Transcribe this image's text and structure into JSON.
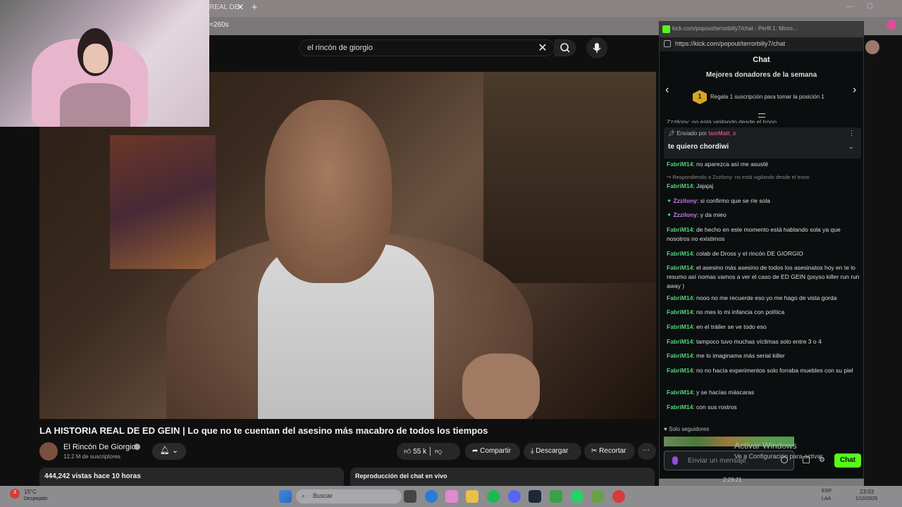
{
  "browser": {
    "tab_title": "REAL DE ED",
    "url_fragment": "=260s",
    "new_tab": "+",
    "close": "✕"
  },
  "youtube": {
    "search_query": "el rincón de giorgio",
    "video_title": "LA HISTORIA REAL DE ED GEIN | Lo que no te cuentan del asesino más macabro de todos los tiempos",
    "channel_name": "El Rincón De Giorgio",
    "subscribers": "12.2 M de suscriptores",
    "likes": "55 k",
    "share": "Compartir",
    "download": "Descargar",
    "clip": "Recortar",
    "views": "444,242 vistas  hace 10 horas",
    "replay_chat": "Reproducción del chat en vivo"
  },
  "kick": {
    "window_title": "kick.com/popout/terrorbilly7/chat - Perfil 1: Micro...",
    "url": "https://kick.com/popout/terrorbilly7/chat",
    "header": "Chat",
    "donors_title": "Mejores donadores de la semana",
    "donors_badge": "1",
    "donors_text": "Regala 1 suscripción para tomar la posición 1",
    "partial_msg": "Zzzilony: no está vigilando desde el trono",
    "pinned_by": "Enviado por",
    "pinned_user": "IamMatt_x",
    "pinned_text": "te quiero chordiwi",
    "reply_to": "Respondiendo a Zzzilony: no está vigilando desde el trono",
    "messages": [
      {
        "user": "FabriM14",
        "text": "no aparezca así me asusté"
      },
      {
        "user": "FabriM14",
        "text": "Jajajaj"
      },
      {
        "user": "Zzzilony",
        "text": "si confirmo que se ríe sola"
      },
      {
        "user": "Zzzilony",
        "text": "y da mieo"
      },
      {
        "user": "FabriM14",
        "text": "de hecho en este momento está hablando sola ya que nosotros no existimos"
      },
      {
        "user": "FabriM14",
        "text": "colab de Dross y el rincón DE GIORGIO"
      },
      {
        "user": "FabriM14",
        "text": "el asesino más asesino de todos los asesinatos hoy en te lo resumo así nomas vamos a ver el caso de ED GEIN (psyso killer run run away )"
      },
      {
        "user": "FabriM14",
        "text": "nooo no me recuerde eso yo me hago de vista gorda"
      },
      {
        "user": "FabriM14",
        "text": "no mes lo mi infancia con política"
      },
      {
        "user": "FabriM14",
        "text": "en el tráiler se ve todo eso"
      },
      {
        "user": "FabriM14",
        "text": "tampoco tuvo muchas víctimas solo entre 3 o 4"
      },
      {
        "user": "FabriM14",
        "text": "me lo imaginama más serial killer"
      },
      {
        "user": "FabriM14",
        "text": "no no hacía experimentos solo forraba muebles con su piel"
      },
      {
        "user": "FabriM14",
        "text": "y se hacías máscaras"
      },
      {
        "user": "FabriM14",
        "text": "con sus rostros"
      }
    ],
    "followers_only": "Solo seguidores",
    "input_placeholder": "Enviar un mensaje",
    "send_button": "Chat",
    "timestamp": "2:29:21"
  },
  "watermark": {
    "line1": "Activar Windows",
    "line2": "Ve a Configuración para activar"
  },
  "taskbar": {
    "weather_temp": "15°C",
    "weather_desc": "Despejado",
    "search_placeholder": "Buscar",
    "lang1": "ESP",
    "lang2": "LAA",
    "time": "23:03",
    "date": "1/10/2025",
    "weather_badge": "3"
  },
  "colors": {
    "kick_green": "#53fc18",
    "username_green": "#52d27a",
    "username_purple": "#c27be6"
  }
}
